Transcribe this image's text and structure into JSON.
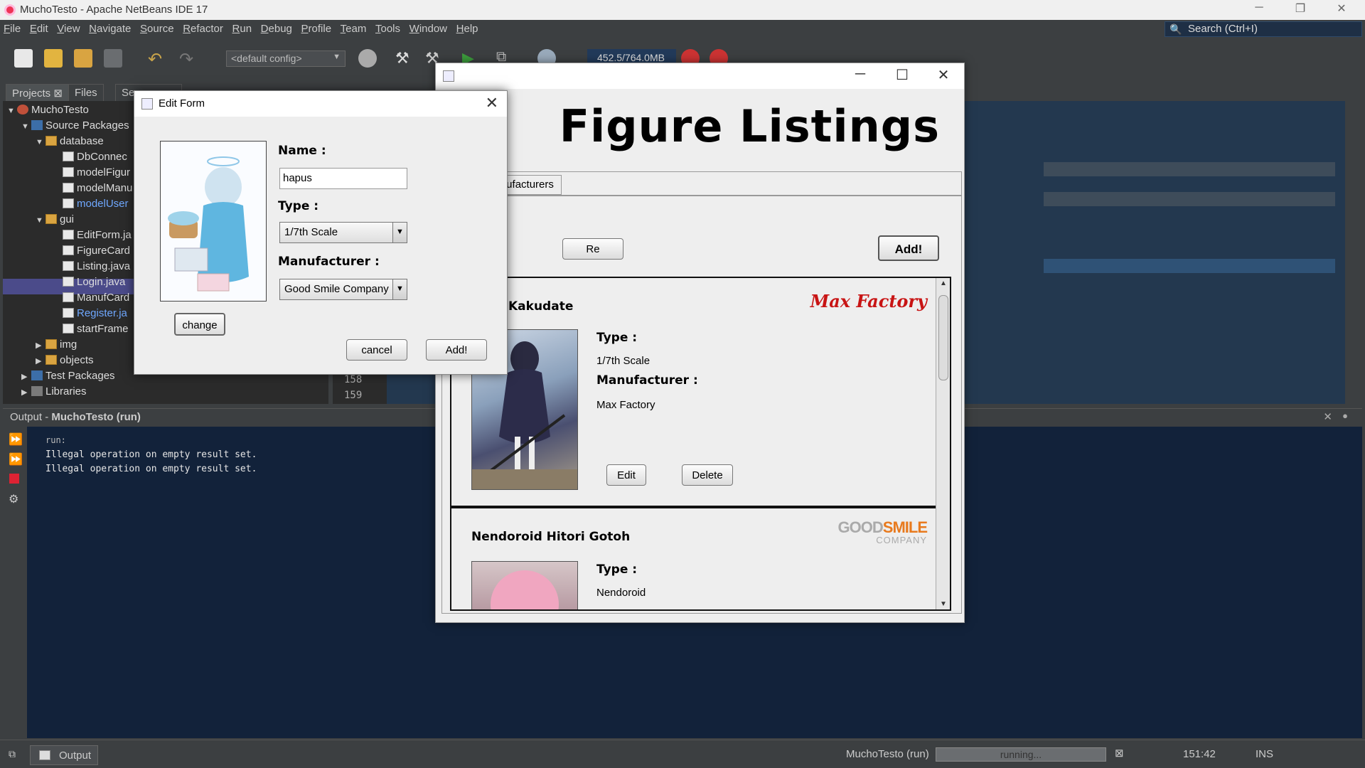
{
  "ide": {
    "title": "MuchoTesto - Apache NetBeans IDE 17",
    "menu": [
      "File",
      "Edit",
      "View",
      "Navigate",
      "Source",
      "Refactor",
      "Run",
      "Debug",
      "Profile",
      "Team",
      "Tools",
      "Window",
      "Help"
    ],
    "search_placeholder": "Search (Ctrl+I)",
    "config": "<default config>",
    "memory": "452.5/764.0MB"
  },
  "projects_panel": {
    "tabs": [
      "Projects",
      "Files",
      "Se..."
    ],
    "tree": [
      {
        "label": "MuchoTesto"
      },
      {
        "label": "Source Packages"
      },
      {
        "label": "database"
      },
      {
        "label": "DbConnec"
      },
      {
        "label": "modelFigur"
      },
      {
        "label": "modelManu"
      },
      {
        "label": "modelUser"
      },
      {
        "label": "gui"
      },
      {
        "label": "EditForm.ja"
      },
      {
        "label": "FigureCard"
      },
      {
        "label": "Listing.java"
      },
      {
        "label": "Login.java"
      },
      {
        "label": "ManufCard"
      },
      {
        "label": "Register.ja"
      },
      {
        "label": "startFrame"
      },
      {
        "label": "img"
      },
      {
        "label": "objects"
      },
      {
        "label": "Test Packages"
      },
      {
        "label": "Libraries"
      }
    ],
    "line_numbers": [
      "158",
      "159"
    ]
  },
  "output": {
    "title_prefix": "Output - ",
    "title_bold": "MuchoTesto (run)",
    "lines": [
      "run:",
      "Illegal operation on empty result set.",
      "Illegal operation on empty result set."
    ]
  },
  "statusbar": {
    "output_button": "Output",
    "run_label": "MuchoTesto (run)",
    "progress_text": "running...",
    "position": "151:42",
    "mode": "INS"
  },
  "listing_window": {
    "heading": "Figure Listings",
    "tab_manufacturers": "Manufacturers",
    "refresh_button": "Re",
    "add_button": "Add!",
    "cards": [
      {
        "name": "Kakudate",
        "type_label": "Type :",
        "type": "1/7th Scale",
        "manufacturer_label": "Manufacturer :",
        "manufacturer": "Max Factory",
        "brand_logo": "Max Factory",
        "edit": "Edit",
        "delete": "Delete"
      },
      {
        "name": "Nendoroid Hitori Gotoh",
        "type_label": "Type :",
        "type": "Nendoroid",
        "brand_logo_top_a": "GOOD",
        "brand_logo_top_b": "SMILE",
        "brand_logo_bottom": "COMPANY"
      }
    ]
  },
  "edit_form": {
    "title": "Edit Form",
    "name_label": "Name :",
    "name_value": "hapus",
    "type_label": "Type :",
    "type_value": "1/7th Scale",
    "manufacturer_label": "Manufacturer :",
    "manufacturer_value": "Good Smile Company",
    "change_button": "change",
    "cancel_button": "cancel",
    "add_button": "Add!"
  },
  "colors": {
    "ide_bg": "#3c3f41",
    "editor_bg": "#23384f",
    "output_bg": "#12223a",
    "selection": "#4b4b8a",
    "max_factory_red": "#c81414",
    "gsc_orange": "#e87a1e"
  }
}
